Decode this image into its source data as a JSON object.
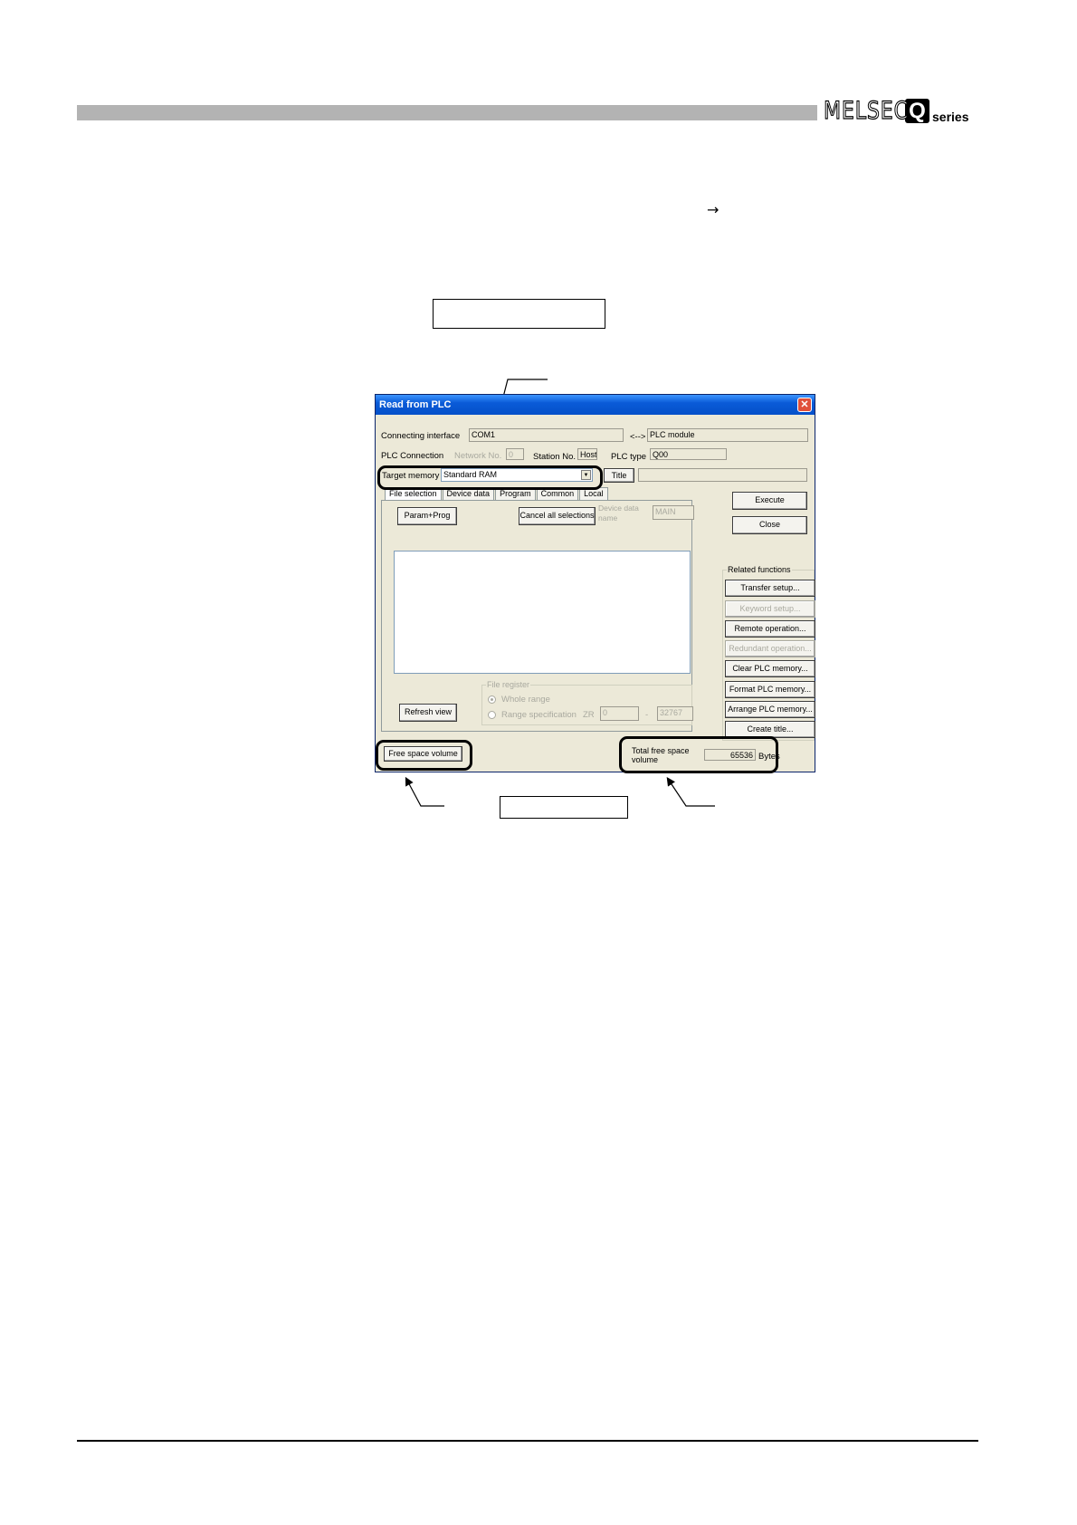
{
  "header": {
    "logo_brand": "MELSEC",
    "logo_q": "Q",
    "logo_series": "series",
    "arrow": "→"
  },
  "dialog": {
    "title": "Read from PLC",
    "connecting_interface_label": "Connecting interface",
    "connecting_interface_value": "COM1",
    "arrow_label": "<-->",
    "connection_target": "PLC module",
    "plc_connection_label": "PLC Connection",
    "network_no_label": "Network No.",
    "network_no_value": "0",
    "station_no_label": "Station No.",
    "station_no_value": "Host",
    "plc_type_label": "PLC type",
    "plc_type_value": "Q00",
    "target_memory_label": "Target memory",
    "target_memory_value": "Standard RAM",
    "title_button": "Title",
    "title_value": "",
    "tabs": [
      "File selection",
      "Device data",
      "Program",
      "Common",
      "Local"
    ],
    "param_prog_button": "Param+Prog",
    "cancel_all_button": "Cancel all selections",
    "device_data_name_label": "Device data name",
    "device_data_name_value": "MAIN",
    "file_register_label": "File register",
    "whole_range_label": "Whole range",
    "range_spec_label": "Range specification",
    "zr_label": "ZR",
    "range_from": "0",
    "range_sep": "-",
    "range_to": "32767",
    "refresh_view_button": "Refresh view",
    "execute_button": "Execute",
    "close_button": "Close",
    "related_functions_label": "Related functions",
    "related_buttons": [
      {
        "label": "Transfer setup...",
        "enabled": true
      },
      {
        "label": "Keyword setup...",
        "enabled": false
      },
      {
        "label": "Remote operation...",
        "enabled": true
      },
      {
        "label": "Redundant operation...",
        "enabled": false
      },
      {
        "label": "Clear PLC memory...",
        "enabled": true
      },
      {
        "label": "Format PLC memory...",
        "enabled": true
      },
      {
        "label": "Arrange PLC memory...",
        "enabled": true
      },
      {
        "label": "Create title...",
        "enabled": true
      }
    ],
    "free_space_button": "Free space volume",
    "total_free_space_label": "Total free space volume",
    "total_free_space_value": "65536",
    "bytes_label": "Bytes"
  }
}
